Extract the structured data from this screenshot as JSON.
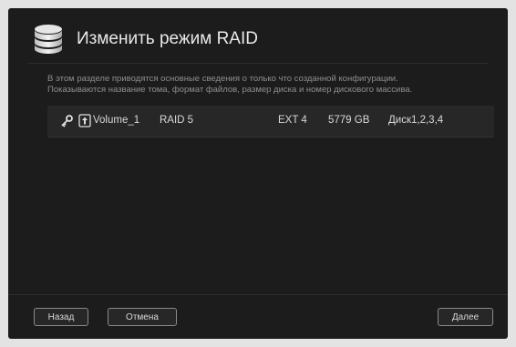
{
  "header": {
    "icon": "database-icon",
    "title": "Изменить режим RAID"
  },
  "description": {
    "line1": "В этом разделе приводятся основные сведения о только что созданной конфигурации.",
    "line2": "Показываются название тома, формат файлов, размер диска и номер дискового массива."
  },
  "volume": {
    "name": "Volume_1",
    "raid": "RAID 5",
    "filesystem": "EXT 4",
    "size": "5779 GB",
    "disks": "Диск1,2,3,4"
  },
  "buttons": {
    "back": "Назад",
    "cancel": "Отмена",
    "next": "Далее"
  }
}
